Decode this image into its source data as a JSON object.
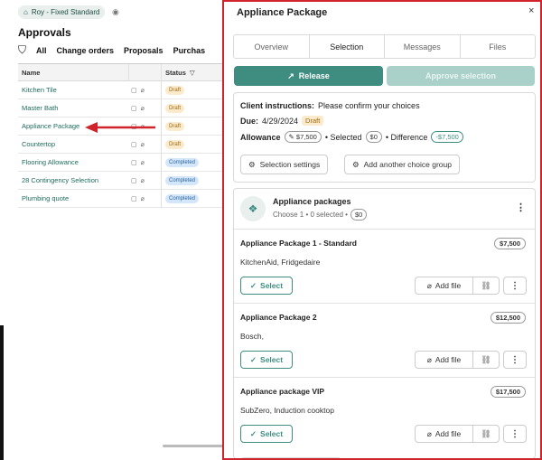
{
  "left": {
    "project_chip": "Roy - Fixed Standard",
    "section_title": "Approvals",
    "filters": [
      "All",
      "Change orders",
      "Proposals",
      "Purchas"
    ],
    "table": {
      "headers": [
        "Name",
        "Status"
      ],
      "rows": [
        {
          "name": "Kitchen Tile",
          "status": "Draft"
        },
        {
          "name": "Master Bath",
          "status": "Draft"
        },
        {
          "name": "Appliance Package",
          "status": "Draft"
        },
        {
          "name": "Countertop",
          "status": "Draft"
        },
        {
          "name": "Flooring Allowance",
          "status": "Completed"
        },
        {
          "name": "28 Contingency Selection",
          "status": "Completed"
        },
        {
          "name": "Plumbing quote",
          "status": "Completed"
        }
      ]
    }
  },
  "modal": {
    "title": "Appliance Package",
    "close": "×",
    "tabs": [
      "Overview",
      "Selection",
      "Messages",
      "Files"
    ],
    "active_tab": "Selection",
    "release_label": "Release",
    "approve_label": "Approve selection",
    "instructions": {
      "label": "Client instructions:",
      "text": "Please confirm your choices",
      "due_label": "Due:",
      "due_date": "4/29/2024",
      "status": "Draft",
      "allowance_label": "Allowance",
      "allowance_value": "$7,500",
      "selected_label": "• Selected",
      "selected_value": "$0",
      "difference_label": "• Difference",
      "difference_value": "-$7,500"
    },
    "selection_settings_label": "Selection settings",
    "add_group_label": "Add another choice group",
    "group": {
      "title": "Appliance packages",
      "subtitle": "Choose 1 • 0 selected •",
      "subtitle_value": "$0",
      "items": [
        {
          "name": "Appliance Package 1 - Standard",
          "price": "$7,500",
          "desc": "KitchenAid, Fridgedaire"
        },
        {
          "name": "Appliance Package 2",
          "price": "$12,500",
          "desc": "Bosch,"
        },
        {
          "name": "Appliance package VIP",
          "price": "$17,500",
          "desc": "SubZero, Induction cooktop"
        }
      ],
      "select_label": "Select",
      "add_file_label": "Add file"
    }
  },
  "colors": {
    "accent": "#3f8d81",
    "highlight_border": "#d0232b",
    "arrow": "#d0232b"
  }
}
